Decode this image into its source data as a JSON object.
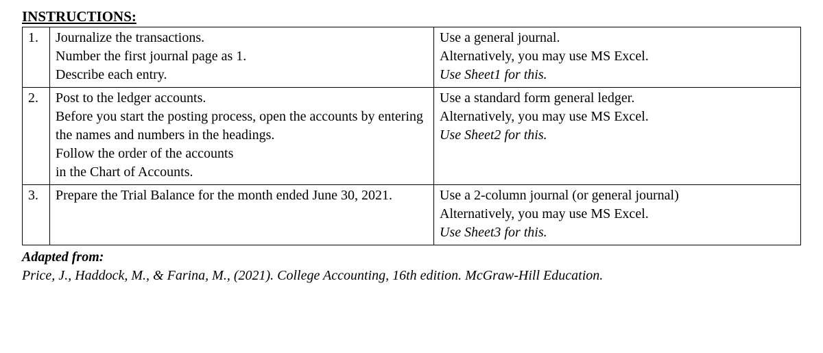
{
  "title": "INSTRUCTIONS:",
  "rows": [
    {
      "num": "1.",
      "task_line1": "Journalize the transactions.",
      "task_line2": "Number the first journal page as 1.",
      "task_line3": "Describe each entry.",
      "method_line1": "Use a general journal.",
      "method_line2": "Alternatively, you may use MS Excel.",
      "method_line3_italic": "Use Sheet1 for this."
    },
    {
      "num": "2.",
      "task_line1": "Post to the ledger accounts.",
      "task_line2": "Before you start the posting process, open the accounts by entering the names and numbers in the headings.",
      "task_line3": "Follow the order of the accounts",
      "task_line4": "in the Chart of Accounts.",
      "method_line1": "Use a standard form general ledger.",
      "method_line2": "Alternatively, you may use MS Excel.",
      "method_line3_italic": "Use Sheet2 for this."
    },
    {
      "num": "3.",
      "task_line1": "Prepare the Trial Balance for the month ended June 30, 2021.",
      "method_line1": "Use a 2-column journal (or general journal)",
      "method_line2": "Alternatively, you may use MS Excel.",
      "method_line3_italic": "Use Sheet3 for this."
    }
  ],
  "footer": {
    "lead": "Adapted from:",
    "citation": "Price, J., Haddock, M., & Farina, M., (2021). College Accounting, 16th edition. McGraw-Hill Education."
  }
}
